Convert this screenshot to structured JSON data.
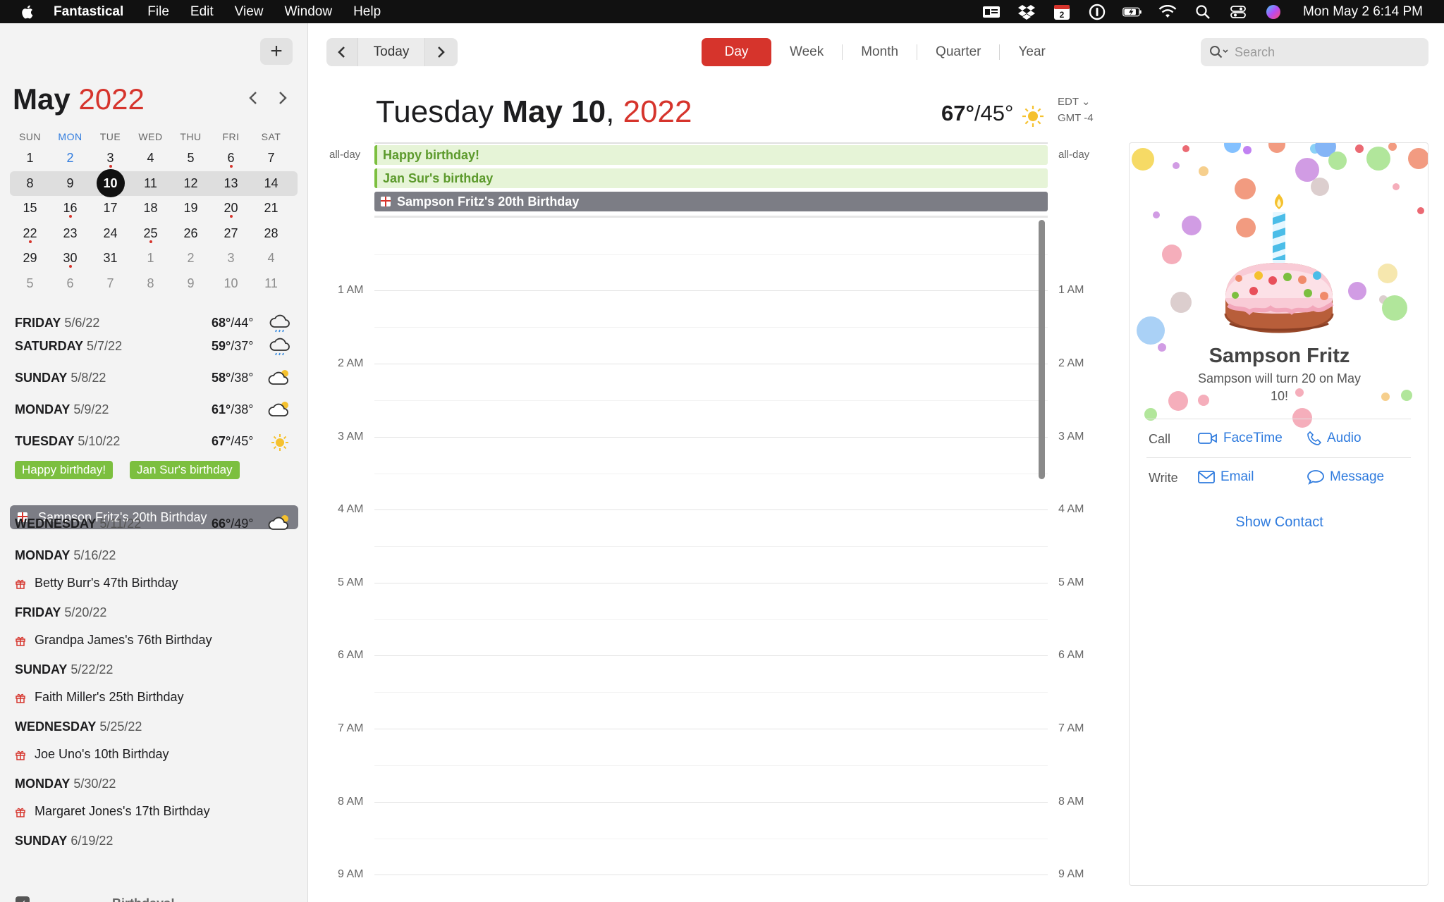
{
  "menubar": {
    "app_name": "Fantastical",
    "menus": [
      "File",
      "Edit",
      "View",
      "Window",
      "Help"
    ],
    "calendar_badge": "2",
    "clock": "Mon May 2  6:14 PM"
  },
  "sidebar": {
    "add_label": "+",
    "month": "May",
    "year": "2022",
    "weekdays": [
      "SUN",
      "MON",
      "TUE",
      "WED",
      "THU",
      "FRI",
      "SAT"
    ],
    "weeks": [
      [
        "1",
        "2",
        "3",
        "4",
        "5",
        "6",
        "7"
      ],
      [
        "8",
        "9",
        "10",
        "11",
        "12",
        "13",
        "14"
      ],
      [
        "15",
        "16",
        "17",
        "18",
        "19",
        "20",
        "21"
      ],
      [
        "22",
        "23",
        "24",
        "25",
        "26",
        "27",
        "28"
      ],
      [
        "29",
        "30",
        "31",
        "1",
        "2",
        "3",
        "4"
      ],
      [
        "5",
        "6",
        "7",
        "8",
        "9",
        "10",
        "11"
      ]
    ],
    "agenda": [
      {
        "day": "FRIDAY",
        "date": "5/6/22",
        "hi": "68°",
        "lo": "/44°",
        "weather": "rain-icon"
      },
      {
        "day": "SATURDAY",
        "date": "5/7/22",
        "hi": "59°",
        "lo": "/37°",
        "weather": "rain-icon"
      },
      {
        "day": "SUNDAY",
        "date": "5/8/22",
        "hi": "58°",
        "lo": "/38°",
        "weather": "partly-cloudy-icon"
      },
      {
        "day": "MONDAY",
        "date": "5/9/22",
        "hi": "61°",
        "lo": "/38°",
        "weather": "partly-cloudy-icon"
      },
      {
        "day": "TUESDAY",
        "date": "5/10/22",
        "hi": "67°",
        "lo": "/45°",
        "weather": "sun-icon"
      },
      {
        "day": "WEDNESDAY",
        "date": "5/11/22",
        "hi": "66°",
        "lo": "/49°",
        "weather": "partly-cloudy-icon"
      },
      {
        "day": "MONDAY",
        "date": "5/16/22"
      },
      {
        "day": "FRIDAY",
        "date": "5/20/22"
      },
      {
        "day": "SUNDAY",
        "date": "5/22/22"
      },
      {
        "day": "WEDNESDAY",
        "date": "5/25/22"
      },
      {
        "day": "MONDAY",
        "date": "5/30/22"
      },
      {
        "day": "SUNDAY",
        "date": "6/19/22"
      }
    ],
    "tuesday_tags": [
      "Happy birthday!",
      "Jan Sur's birthday"
    ],
    "selected_event": "Sampson Fritz's 20th Birthday",
    "events": [
      "Betty Burr's 47th Birthday",
      "Grandpa James's 76th Birthday",
      "Faith Miller's 25th Birthday",
      "Joe Uno's 10th Birthday",
      "Margaret Jones's 17th Birthday"
    ],
    "calendar_set": "Birthdays!"
  },
  "toolbar": {
    "today": "Today",
    "views": [
      "Day",
      "Week",
      "Month",
      "Quarter",
      "Year"
    ],
    "active_view": "Day",
    "search_placeholder": "Search"
  },
  "day": {
    "weekday": "Tuesday",
    "month_day": "May 10",
    "comma": ",",
    "year": "2022",
    "hi": "67°",
    "lo": "/45°",
    "tz": "EDT",
    "gmt": "GMT -4",
    "allday_label": "all-day",
    "allday_events": [
      "Happy birthday!",
      "Jan Sur's birthday",
      "Sampson Fritz's 20th Birthday"
    ],
    "hours": [
      "1 AM",
      "2 AM",
      "3 AM",
      "4 AM",
      "5 AM",
      "6 AM",
      "7 AM",
      "8 AM",
      "9 AM"
    ]
  },
  "card": {
    "name": "Sampson Fritz",
    "subtitle": "Sampson will turn 20 on May 10!",
    "call_label": "Call",
    "write_label": "Write",
    "facetime": "FaceTime",
    "audio": "Audio",
    "email": "Email",
    "message": "Message",
    "show_contact": "Show Contact"
  },
  "colors": {
    "accent_red": "#d6342c",
    "link_blue": "#2f7bde",
    "event_green": "#7cbf3f",
    "event_gray": "#7c7d85"
  }
}
